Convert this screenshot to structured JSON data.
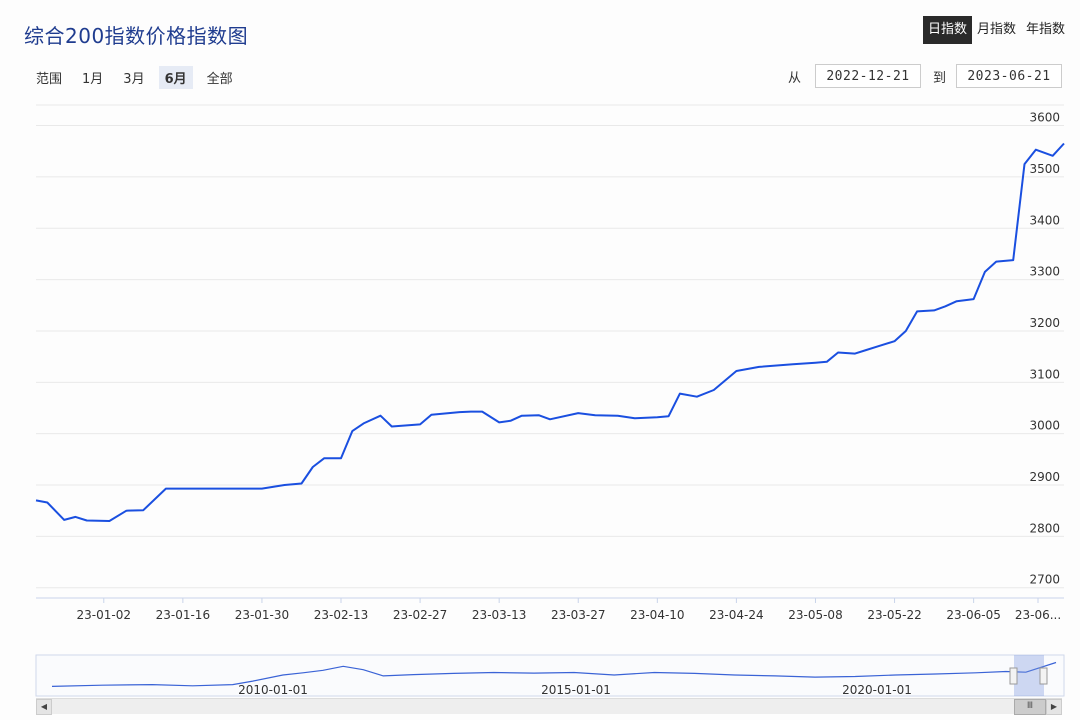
{
  "title": "综合200指数价格指数图",
  "period_toggle": {
    "items": [
      "日指数",
      "月指数",
      "年指数"
    ],
    "active_index": 0
  },
  "range": {
    "label": "范围",
    "buttons": [
      "1月",
      "3月",
      "6月",
      "全部"
    ],
    "active_index": 2
  },
  "date_range": {
    "from_label": "从",
    "from_value": "2022-12-21",
    "to_label": "到",
    "to_value": "2023-06-21"
  },
  "colors": {
    "line": "#1a4fe0",
    "accent": "#1f3c8f"
  },
  "chart_data": {
    "type": "line",
    "title": "综合200指数价格指数图",
    "ylim": [
      2680,
      3640
    ],
    "yticks": [
      "2700",
      "2800",
      "2900",
      "3000",
      "3100",
      "3200",
      "3300",
      "3400",
      "3500",
      "3600"
    ],
    "xticks": [
      "23-01-02",
      "23-01-16",
      "23-01-30",
      "23-02-13",
      "23-02-27",
      "23-03-13",
      "23-03-27",
      "23-04-10",
      "23-04-24",
      "23-05-08",
      "23-05-22",
      "23-06-05",
      "23-06..."
    ],
    "grid": true,
    "series": [
      {
        "x": [
          "2022-12-21",
          "2022-12-23",
          "2022-12-26",
          "2022-12-28",
          "2022-12-30",
          "2023-01-03",
          "2023-01-06",
          "2023-01-09",
          "2023-01-13",
          "2023-01-16",
          "2023-01-23",
          "2023-01-27",
          "2023-01-30",
          "2023-02-03",
          "2023-02-06",
          "2023-02-08",
          "2023-02-10",
          "2023-02-13",
          "2023-02-15",
          "2023-02-17",
          "2023-02-20",
          "2023-02-22",
          "2023-02-27",
          "2023-03-01",
          "2023-03-06",
          "2023-03-08",
          "2023-03-10",
          "2023-03-13",
          "2023-03-15",
          "2023-03-17",
          "2023-03-20",
          "2023-03-22",
          "2023-03-27",
          "2023-03-30",
          "2023-04-03",
          "2023-04-06",
          "2023-04-10",
          "2023-04-12",
          "2023-04-14",
          "2023-04-17",
          "2023-04-20",
          "2023-04-24",
          "2023-04-28",
          "2023-05-04",
          "2023-05-08",
          "2023-05-10",
          "2023-05-12",
          "2023-05-15",
          "2023-05-17",
          "2023-05-19",
          "2023-05-22",
          "2023-05-24",
          "2023-05-26",
          "2023-05-29",
          "2023-05-31",
          "2023-06-02",
          "2023-06-05",
          "2023-06-07",
          "2023-06-09",
          "2023-06-12",
          "2023-06-14",
          "2023-06-16",
          "2023-06-19",
          "2023-06-21"
        ],
        "values": [
          2870,
          2866,
          2832,
          2838,
          2831,
          2830,
          2850,
          2851,
          2893,
          2893,
          2893,
          2893,
          2893,
          2900,
          2903,
          2935,
          2952,
          2952,
          3005,
          3020,
          3035,
          3014,
          3018,
          3037,
          3042,
          3043,
          3043,
          3022,
          3025,
          3035,
          3036,
          3028,
          3040,
          3036,
          3035,
          3030,
          3032,
          3034,
          3078,
          3072,
          3085,
          3122,
          3130,
          3135,
          3138,
          3140,
          3158,
          3156,
          3163,
          3170,
          3180,
          3200,
          3238,
          3240,
          3248,
          3258,
          3262,
          3315,
          3335,
          3338,
          3525,
          3553,
          3541,
          3565
        ]
      }
    ],
    "navigator": {
      "xticks": [
        "2010-01-01",
        "2015-01-01",
        "2020-01-01"
      ]
    }
  }
}
